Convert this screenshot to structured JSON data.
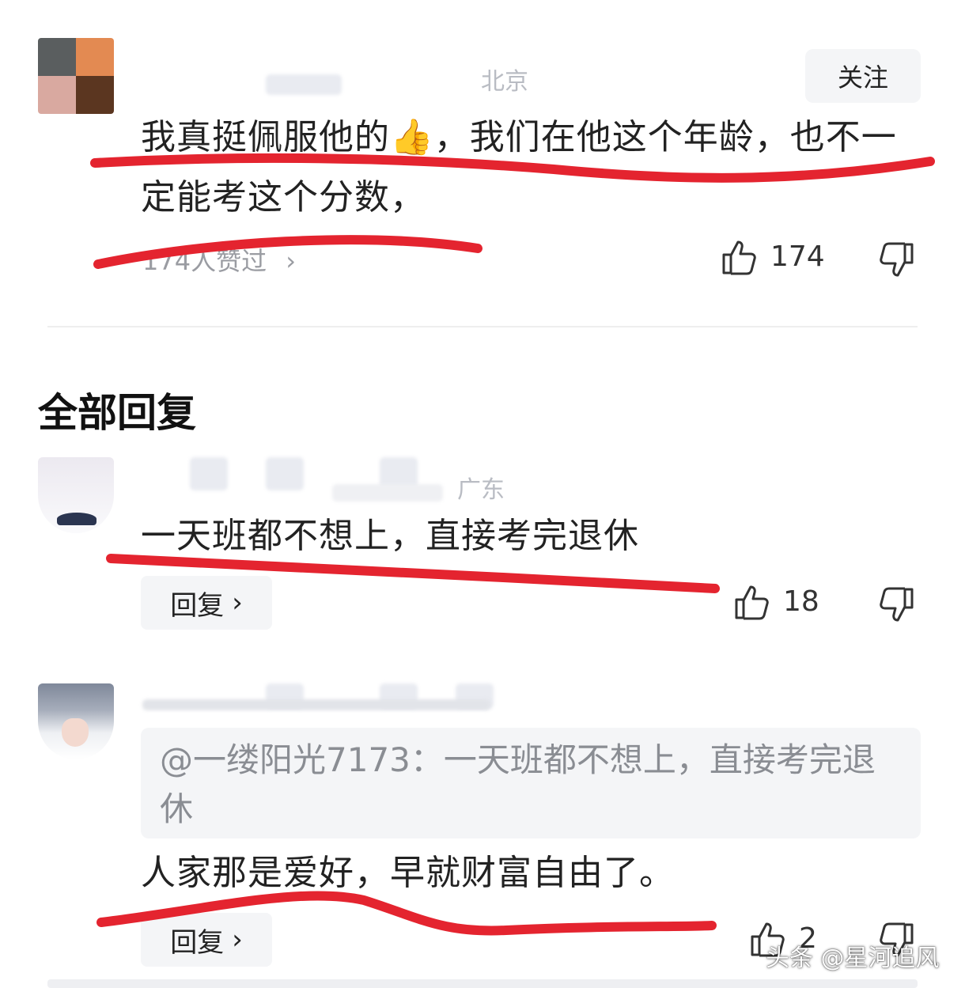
{
  "comment": {
    "location": "北京",
    "follow_label": "关注",
    "text": "我真挺佩服他的👍，我们在他这个年龄，也不一定能考这个分数，",
    "like_summary": "174人赞过",
    "like_count": "174"
  },
  "replies_section": {
    "title": "全部回复"
  },
  "replies": [
    {
      "location": "广东",
      "text": "一天班都不想上，直接考完退休",
      "reply_label": "回复",
      "like_count": "18"
    },
    {
      "quote": "@一缕阳光7173：一天班都不想上，直接考完退休",
      "text": "人家那是爱好，早就财富自由了。",
      "reply_label": "回复",
      "like_count": "2"
    }
  ],
  "watermark": "头条 @星河追风",
  "colors": {
    "underline_red": "#e4242f",
    "text": "#222222",
    "muted": "#9a9ca2",
    "button_bg": "#f4f5f7"
  },
  "icons": [
    "thumbs-up-icon",
    "thumbs-down-icon",
    "chevron-right-icon"
  ]
}
